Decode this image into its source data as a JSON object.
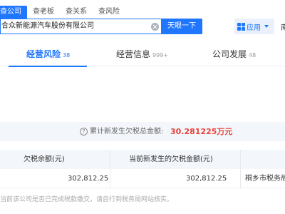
{
  "search": {
    "tabs": [
      "查公司",
      "查老板",
      "查关系",
      "查风险"
    ],
    "query": "合众新能源汽车股份有限公司",
    "button": "天眼一下"
  },
  "apps": {
    "label": "应用",
    "edge": "南"
  },
  "main_tabs": [
    {
      "label": "经营风险",
      "count": "38"
    },
    {
      "label": "经营信息",
      "count": "999+"
    },
    {
      "label": "公司发展",
      "count": "48"
    }
  ],
  "summary": {
    "label": "累计新发生欠税总金额:",
    "value": "30.281225万元"
  },
  "table": {
    "headers": [
      "欠税余额(元)",
      "当前新发生的欠税金额(元)"
    ],
    "row": {
      "balance": "302,812.25",
      "new_amount": "302,812.25",
      "authority": "桐乡市税务局"
    }
  },
  "note": "当前该公司是否已完成税款缴交，请自行到税务局网站核实。",
  "colors": {
    "accent": "#1f76ff",
    "amount": "#e8433a"
  }
}
